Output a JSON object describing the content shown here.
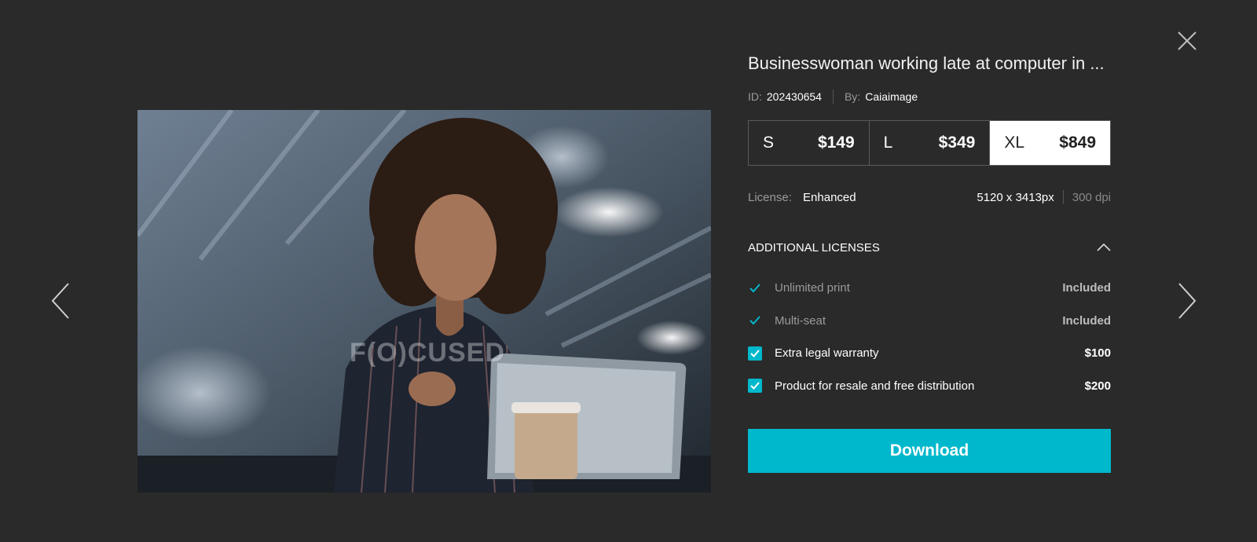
{
  "header": {
    "close_icon": "close-icon"
  },
  "navigation": {
    "prev_icon": "chevron-left-icon",
    "next_icon": "chevron-right-icon"
  },
  "photo": {
    "watermark": "F(O)CUSED"
  },
  "details": {
    "title": "Businesswoman working late at computer in ...",
    "id_label": "ID:",
    "id_value": "202430654",
    "by_label": "By:",
    "by_value": "Caiaimage"
  },
  "sizes": [
    {
      "label": "S",
      "price": "$149",
      "selected": false
    },
    {
      "label": "L",
      "price": "$349",
      "selected": false
    },
    {
      "label": "XL",
      "price": "$849",
      "selected": true
    }
  ],
  "license": {
    "label": "License:",
    "value": "Enhanced",
    "dimensions": "5120 x 3413px",
    "dpi": "300 dpi"
  },
  "additional": {
    "heading": "ADDITIONAL LICENSES",
    "options": [
      {
        "label": "Unlimited print",
        "value": "Included",
        "type": "included"
      },
      {
        "label": "Multi-seat",
        "value": "Included",
        "type": "included"
      },
      {
        "label": "Extra legal warranty",
        "value": "$100",
        "type": "checkbox",
        "checked": true
      },
      {
        "label": "Product for resale and free distribution",
        "value": "$200",
        "type": "checkbox",
        "checked": true
      }
    ]
  },
  "actions": {
    "download_label": "Download"
  },
  "colors": {
    "background": "#2a2a2a",
    "accent": "#00b8cc",
    "selected_bg": "#ffffff"
  }
}
